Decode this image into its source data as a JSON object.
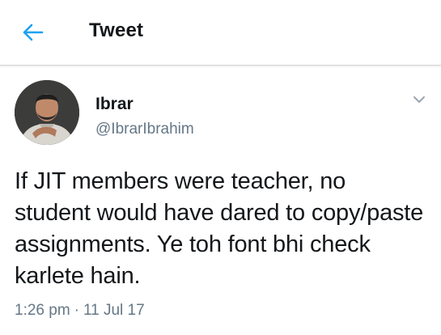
{
  "header": {
    "title": "Tweet",
    "back_icon": "arrow-left-icon",
    "accent_color": "#1da1f2"
  },
  "tweet": {
    "display_name": "Ibrar",
    "handle": "@IbrarIbrahim",
    "text": "If JIT members were teacher, no student would have dared to copy/paste assignments. Ye toh font bhi check karlete hain.",
    "time": "1:26 pm",
    "separator": "·",
    "date": "11 Jul 17",
    "menu_icon": "chevron-down-icon",
    "avatar_icon": "user-photo"
  }
}
